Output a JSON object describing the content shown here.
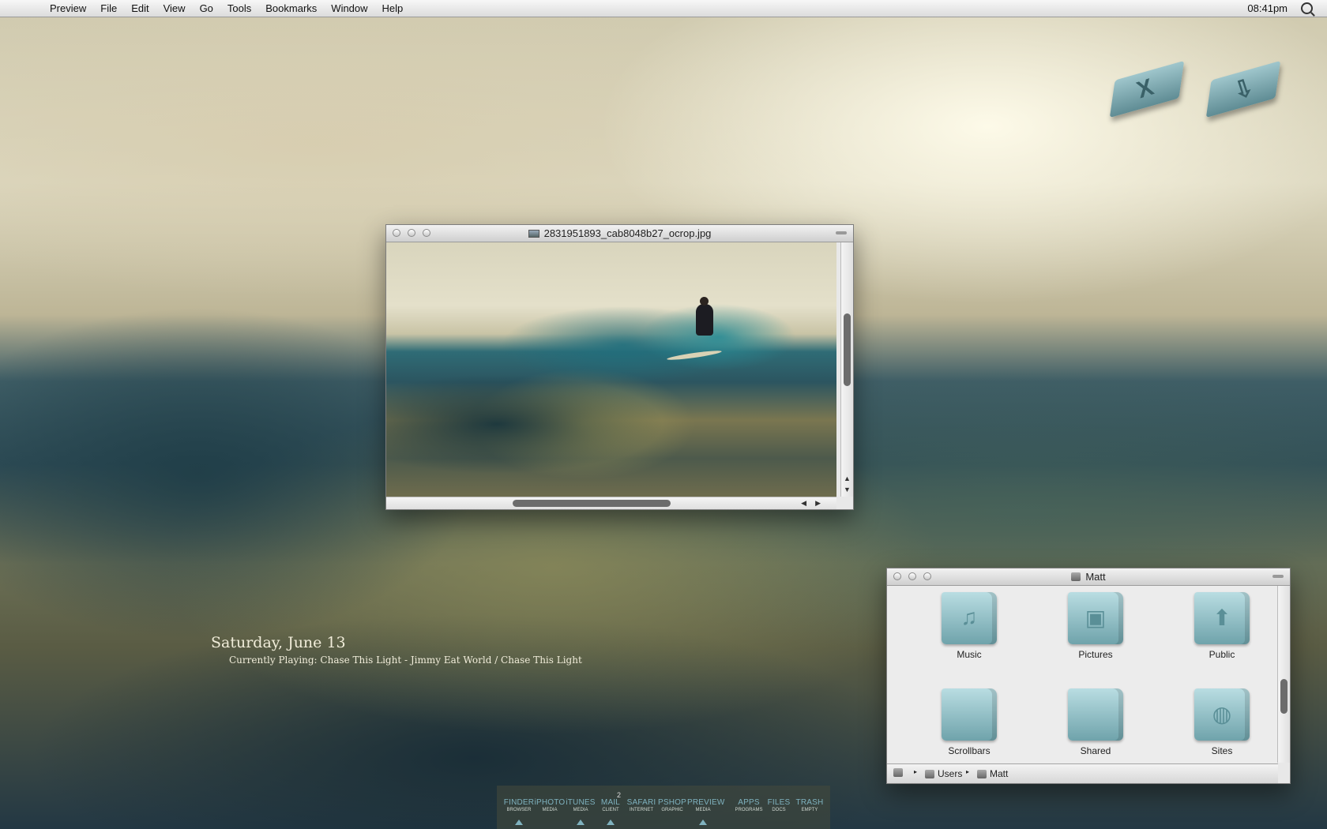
{
  "menubar": {
    "apple": "",
    "menus": [
      "Preview",
      "File",
      "Edit",
      "View",
      "Go",
      "Tools",
      "Bookmarks",
      "Window",
      "Help"
    ],
    "clock": "08:41pm"
  },
  "desktop_icons": [
    {
      "name": "close-folder",
      "glyph": "X"
    },
    {
      "name": "download-folder",
      "glyph": "⇩"
    }
  ],
  "preview_window": {
    "title": "2831951893_cab8048b27_ocrop.jpg"
  },
  "finder_window": {
    "title": "Matt",
    "items": [
      {
        "label": "Music",
        "icon": "♫"
      },
      {
        "label": "Pictures",
        "icon": "▣"
      },
      {
        "label": "Public",
        "icon": "⬆"
      },
      {
        "label": "Scrollbars",
        "icon": ""
      },
      {
        "label": "Shared",
        "icon": ""
      },
      {
        "label": "Sites",
        "icon": "◍"
      }
    ],
    "path": [
      "Users",
      "Matt"
    ]
  },
  "desktop_text": {
    "date": "Saturday, June 13",
    "now_playing": "Currently Playing: Chase This Light - Jimmy Eat World / Chase This Light"
  },
  "dock": {
    "items": [
      {
        "main": "FINDER",
        "sub": "BROWSER",
        "running": true
      },
      {
        "main": "iPHOTO",
        "sub": "MEDIA",
        "running": false
      },
      {
        "main": "iTUNES",
        "sub": "MEDIA",
        "running": true
      },
      {
        "main": "MAIL",
        "sub": "CLIENT",
        "running": true,
        "badge": "2"
      },
      {
        "main": "SAFARI",
        "sub": "INTERNET",
        "running": false
      },
      {
        "main": "PSHOP",
        "sub": "GRAPHIC",
        "running": false
      },
      {
        "main": "PREVIEW",
        "sub": "MEDIA",
        "running": true
      },
      {
        "main": "APPS",
        "sub": "PROGRAMS",
        "running": false
      },
      {
        "main": "FILES",
        "sub": "DOCS",
        "running": false
      },
      {
        "main": "TRASH",
        "sub": "EMPTY",
        "running": false
      }
    ]
  }
}
